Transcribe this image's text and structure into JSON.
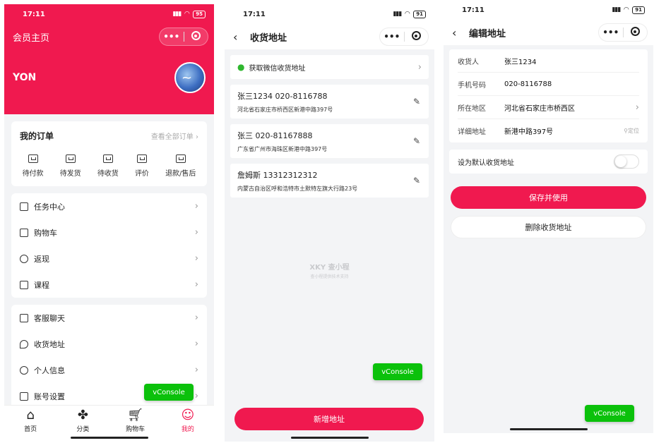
{
  "time": "17:11",
  "battery1": "95",
  "battery2": "91",
  "battery3": "91",
  "capsule": {
    "more": "•••"
  },
  "colors": {
    "accent": "#f0194f",
    "vconsole": "#0bc10b",
    "wechat": "#2fb72f"
  },
  "member": {
    "title": "会员主页",
    "username": "YON",
    "orders_title": "我的订单",
    "orders_all": "查看全部订单",
    "orders": [
      {
        "label": "待付款",
        "icon": "wallet-icon"
      },
      {
        "label": "待发货",
        "icon": "box-icon"
      },
      {
        "label": "待收货",
        "icon": "truck-icon"
      },
      {
        "label": "评价",
        "icon": "comment-icon"
      },
      {
        "label": "退款/售后",
        "icon": "refund-icon"
      }
    ],
    "menu1": [
      {
        "label": "任务中心",
        "icon": "task-icon"
      },
      {
        "label": "购物车",
        "icon": "cart-icon"
      },
      {
        "label": "返现",
        "icon": "cashback-icon"
      },
      {
        "label": "课程",
        "icon": "book-icon"
      }
    ],
    "menu2": [
      {
        "label": "客服聊天",
        "icon": "chat-icon"
      },
      {
        "label": "收货地址",
        "icon": "location-icon"
      },
      {
        "label": "个人信息",
        "icon": "user-icon"
      },
      {
        "label": "账号设置",
        "icon": "settings-icon"
      }
    ],
    "tabs": [
      {
        "label": "首页",
        "icon": "home-icon"
      },
      {
        "label": "分类",
        "icon": "category-icon"
      },
      {
        "label": "购物车",
        "icon": "cart-icon"
      },
      {
        "label": "我的",
        "icon": "profile-icon",
        "active": true
      }
    ],
    "vconsole": "vConsole"
  },
  "address_list": {
    "title": "收货地址",
    "wechat_label": "获取微信收货地址",
    "items": [
      {
        "name_phone": "张三1234 020-8116788",
        "address": "河北省石家庄市桥西区新港中路397号"
      },
      {
        "name_phone": "张三 020-81167888",
        "address": "广东省广州市海珠区新港中路397号"
      },
      {
        "name_phone": "詹姆斯 13312312312",
        "address": "内蒙古自治区呼和浩特市土默特左旗大行路23号"
      }
    ],
    "watermark_title": "XKY 查小程",
    "watermark_sub": "查小程提供技术支持",
    "add_button": "新增地址",
    "vconsole": "vConsole"
  },
  "edit_address": {
    "title": "编辑地址",
    "fields": [
      {
        "key": "收货人",
        "value": "张三1234"
      },
      {
        "key": "手机号码",
        "value": "020-8116788"
      },
      {
        "key": "所在地区",
        "value": "河北省石家庄市桥西区"
      },
      {
        "key": "详细地址",
        "value": "新港中路397号",
        "extra": "定位"
      }
    ],
    "default_label": "设为默认收货地址",
    "default_on": false,
    "save_button": "保存并使用",
    "delete_button": "删除收货地址",
    "vconsole": "vConsole"
  }
}
